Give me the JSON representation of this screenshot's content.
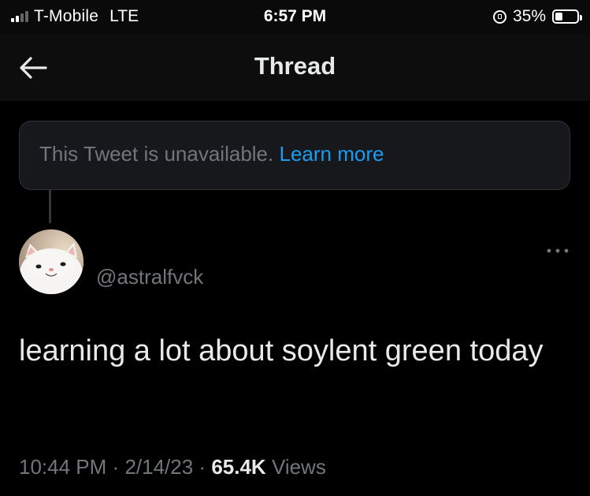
{
  "status_bar": {
    "carrier": "T-Mobile",
    "network": "LTE",
    "time": "6:57 PM",
    "battery_percent": "35%",
    "battery_level": 0.35,
    "signal_bars_filled": 2,
    "signal_bars_total": 4
  },
  "nav": {
    "title": "Thread",
    "back_icon": "arrow-left-icon"
  },
  "unavailable_tweet": {
    "message": "This Tweet is unavailable.",
    "link": "Learn more"
  },
  "tweet": {
    "handle": "@astralfvck",
    "text": "learning a lot about soylent green today",
    "time": "10:44 PM",
    "date": "2/14/23",
    "views_count": "65.4K",
    "views_label": "Views",
    "separator": "·",
    "more_icon": "more-dots-icon"
  },
  "colors": {
    "background": "#000000",
    "link": "#1d9bf0",
    "muted": "#71767b",
    "text": "#e7e9ea"
  }
}
